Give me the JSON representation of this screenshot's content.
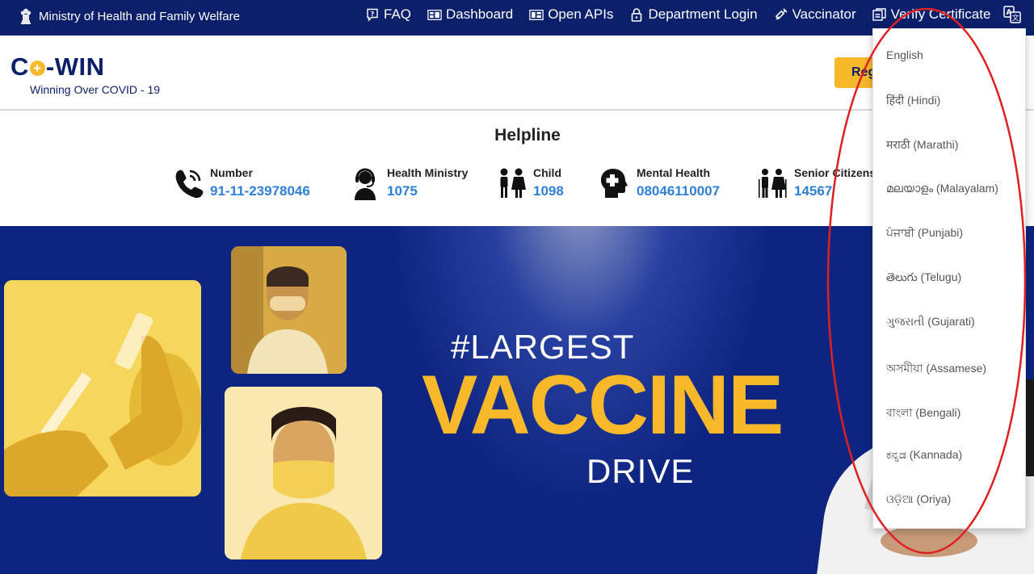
{
  "topbar": {
    "ministry": "Ministry of Health and Family Welfare",
    "nav": [
      {
        "label": "FAQ",
        "icon": "faq-icon"
      },
      {
        "label": "Dashboard",
        "icon": "dashboard-icon"
      },
      {
        "label": "Open APIs",
        "icon": "api-icon"
      },
      {
        "label": "Department Login",
        "icon": "lock-icon"
      },
      {
        "label": "Vaccinator",
        "icon": "syringe-icon"
      },
      {
        "label": "Verify Certificate",
        "icon": "certificate-icon"
      }
    ],
    "language_icon": "translate-icon"
  },
  "header": {
    "logo_left": "C",
    "logo_right": "-WIN",
    "tagline": "Winning Over COVID - 19",
    "register_label": "Register / Sign In"
  },
  "helpline": {
    "title": "Helpline",
    "items": [
      {
        "label": "Number",
        "number": "91-11-23978046",
        "icon": "phone-icon"
      },
      {
        "label": "Health Ministry",
        "number": "1075",
        "icon": "support-agent-icon"
      },
      {
        "label": "Child",
        "number": "1098",
        "icon": "children-icon"
      },
      {
        "label": "Mental Health",
        "number": "08046110007",
        "icon": "mental-health-icon"
      },
      {
        "label": "Senior Citizens",
        "number": "14567",
        "icon": "senior-citizens-icon"
      }
    ]
  },
  "banner": {
    "hashtag": "#LARGEST",
    "headline": "VACCINE",
    "subline": "DRIVE"
  },
  "language_menu": {
    "items": [
      "English",
      "हिंदी (Hindi)",
      "मराठी (Marathi)",
      "മലയാളം (Malayalam)",
      "ਪੰਜਾਬੀ (Punjabi)",
      "తెలుగు (Telugu)",
      "ગુજરાતી (Gujarati)",
      "অসমীয়া (Assamese)",
      "বাংলা (Bengali)",
      "ಕನ್ನಡ (Kannada)",
      "ଓଡ଼ିଆ (Oriya)"
    ]
  },
  "colors": {
    "navy": "#0b1f6b",
    "banner_blue": "#0d2480",
    "accent_yellow": "#f7b82a",
    "link_blue": "#2f80d9",
    "highlight_red": "#e02020"
  }
}
